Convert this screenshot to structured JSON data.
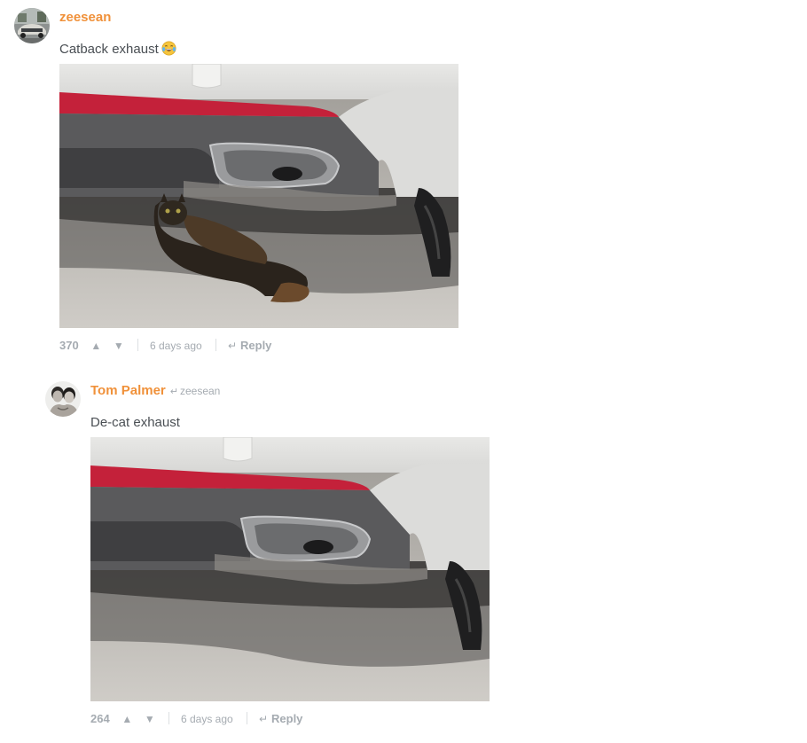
{
  "comments": [
    {
      "author": "zeesean",
      "reply_to": "",
      "text": "Catback exhaust",
      "emoji": "😂",
      "image_alt": "cat hiding under car exhaust",
      "votes": "370",
      "upvote_icon": "▲",
      "downvote_icon": "▼",
      "time": "6 days ago",
      "reply_arrow": "↵",
      "reply_label": "Reply"
    },
    {
      "author": "Tom Palmer",
      "reply_to_arrow": "↵",
      "reply_to": "zeesean",
      "text": "De-cat exhaust",
      "image_alt": "car exhaust with cat removed",
      "votes": "264",
      "upvote_icon": "▲",
      "downvote_icon": "▼",
      "time": "6 days ago",
      "reply_arrow": "↵",
      "reply_label": "Reply"
    }
  ],
  "colors": {
    "author": "#f0913a",
    "muted": "#a5abb1",
    "text": "#4a4f54"
  }
}
